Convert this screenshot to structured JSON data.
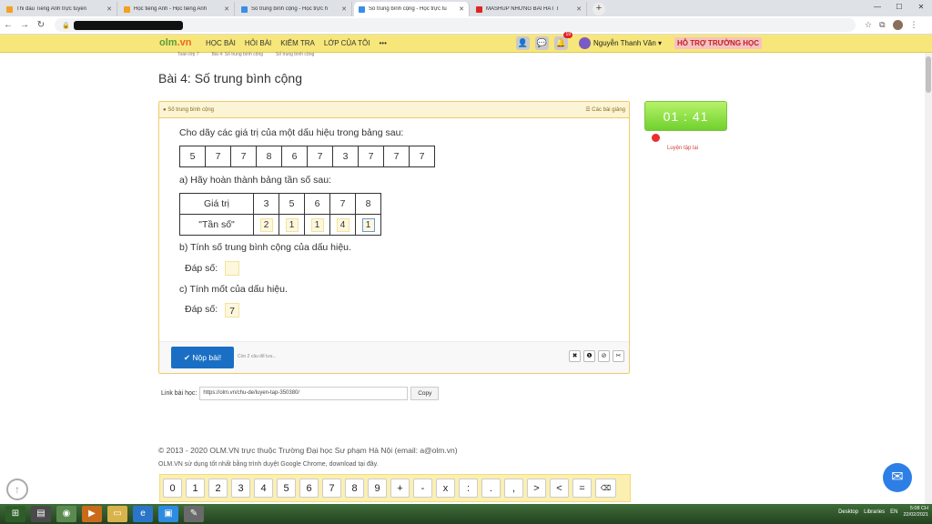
{
  "browser": {
    "tabs": [
      {
        "title": "Thi đấu Tiếng Anh trực tuyến",
        "color": "#f4a11d",
        "active": false
      },
      {
        "title": "Học tiếng Anh - Học tiếng Anh",
        "color": "#f4a11d",
        "active": false
      },
      {
        "title": "Số trung bình cộng - Học trực h",
        "color": "#3a8ee6",
        "active": false
      },
      {
        "title": "Số trung bình cộng - Học trực tu",
        "color": "#3a8ee6",
        "active": true
      },
      {
        "title": "MASHUP NHỮNG BÀI HÁT T",
        "color": "#e02424",
        "active": false
      }
    ],
    "new_tab": "+",
    "win_min": "—",
    "win_max": "☐",
    "win_close": "✕"
  },
  "site": {
    "logo_main": "olm",
    "logo_suffix": ".vn",
    "menu": [
      "HỌC BÀI",
      "HỎI BÀI",
      "KIỂM TRA",
      "LỚP CỦA TÔI",
      "•••"
    ],
    "notif_count": "19",
    "user_name": "Nguyễn Thanh Vân ▾",
    "support": "HỖ TRỢ TRƯỜNG HỌC"
  },
  "breadcrumb": [
    "Toán lớp 7",
    "Bài 4: Số trung bình cộng",
    "Số trung bình cộng"
  ],
  "page_title": "Bài 4: Số trung bình cộng",
  "timer": {
    "value": "01 : 41",
    "retry_label": "Luyện tập lại"
  },
  "panel": {
    "head_left": "● Số trung bình cộng",
    "head_right": "☰ Các bài giảng",
    "prompt": "Cho dãy các giá trị của một dấu hiệu trong bảng sau:",
    "sequence": [
      "5",
      "7",
      "7",
      "8",
      "6",
      "7",
      "3",
      "7",
      "7",
      "7"
    ],
    "part_a": "a) Hãy hoàn thành bảng tần số sau:",
    "freq_header_value": "Giá trị",
    "freq_header_freq": "\"Tần số\"",
    "freq_values": [
      "3",
      "5",
      "6",
      "7",
      "8"
    ],
    "freq_answers": [
      "2",
      "1",
      "1",
      "4",
      "1"
    ],
    "part_b": "b) Tính số trung bình cộng của dấu hiệu.",
    "answer_label_b": "Đáp số:",
    "answer_b": "",
    "part_c": "c) Tính mốt của dấu hiệu.",
    "answer_label_c": "Đáp số:",
    "answer_c": "7",
    "submit_label": "✔ Nộp bài!",
    "saved_note": "Còn 2 câu để lưu...",
    "tools": [
      "✖",
      "❶",
      "⊘",
      "✂"
    ]
  },
  "link": {
    "label": "Link bài học:",
    "url": "https://olm.vn/chu-de/luyen-tap-350380/",
    "copy": "Copy"
  },
  "footer": {
    "line1": "© 2013 - 2020 OLM.VN trực thuộc Trường Đại học Sư phạm Hà Nội (email: a@olm.vn)",
    "line2": "OLM.VN sử dụng tốt nhất bằng trình duyệt Google Chrome, download tại đây."
  },
  "keypad": [
    "0",
    "1",
    "2",
    "3",
    "4",
    "5",
    "6",
    "7",
    "8",
    "9",
    "+",
    "-",
    "x",
    ":",
    ".",
    ",",
    ">",
    "<",
    "="
  ],
  "keypad_back": "⌫",
  "taskbar": {
    "desktop": "Desktop",
    "libraries": "Libraries",
    "lang": "EN",
    "time": "5:08 CH",
    "date": "22/02/2021"
  }
}
